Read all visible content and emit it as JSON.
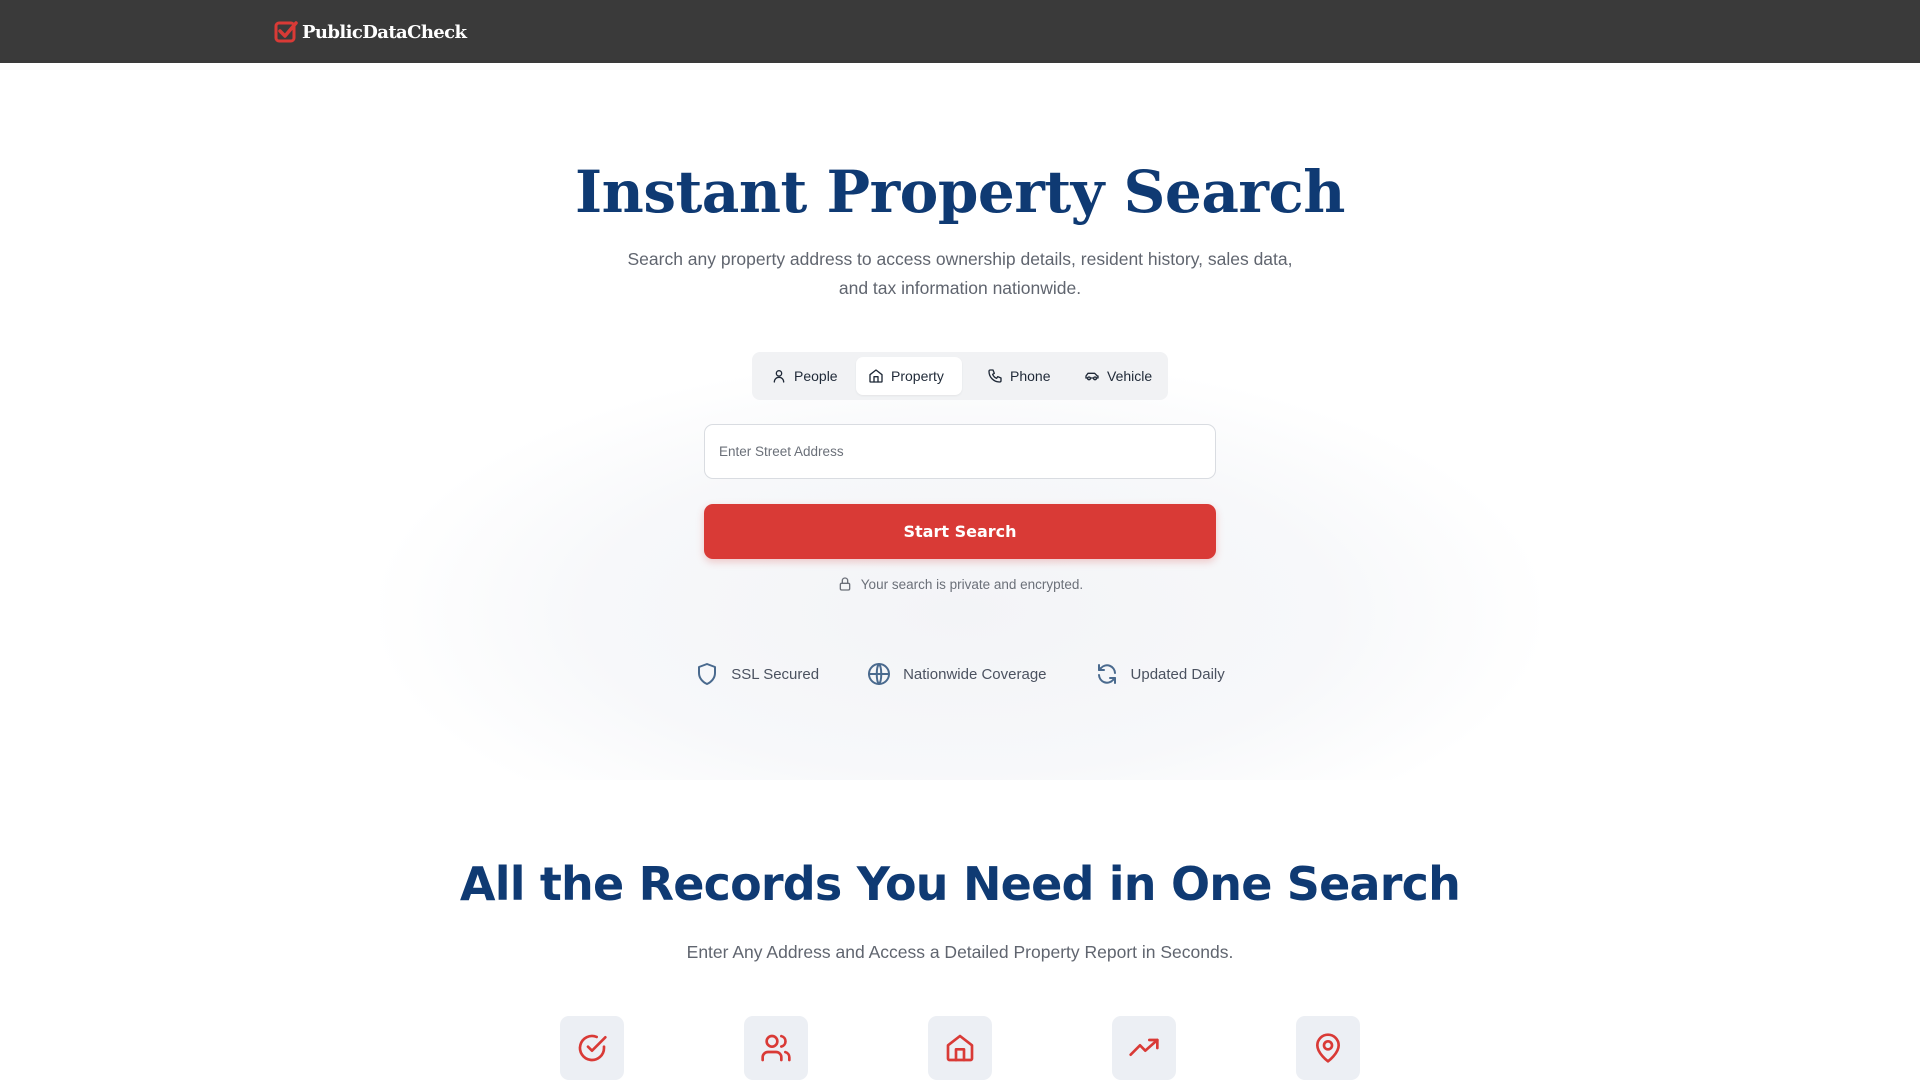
{
  "brand": {
    "name": "PublicDataCheck",
    "accent_color": "#d93a36",
    "title_color": "#0f3a73",
    "header_bg": "#3a3a3a"
  },
  "hero": {
    "title": "Instant Property Search",
    "subtitle_line1": "Search any property address to access ownership details, resident history, sales data,",
    "subtitle_line2": "and tax information nationwide."
  },
  "tabs": [
    {
      "label": "People",
      "icon": "user-icon",
      "active": false
    },
    {
      "label": "Property",
      "icon": "home-icon",
      "active": true
    },
    {
      "label": "Phone",
      "icon": "phone-icon",
      "active": false
    },
    {
      "label": "Vehicle",
      "icon": "car-icon",
      "active": false
    }
  ],
  "search": {
    "placeholder": "Enter Street Address",
    "value": "",
    "button_label": "Start Search",
    "privacy_note": "Your search is private and encrypted."
  },
  "badges": [
    {
      "label": "SSL Secured",
      "icon": "shield-icon"
    },
    {
      "label": "Nationwide Coverage",
      "icon": "globe-icon"
    },
    {
      "label": "Updated Daily",
      "icon": "refresh-icon"
    }
  ],
  "records": {
    "title": "All the Records You Need in One Search",
    "subtitle": "Enter Any Address and Access a Detailed Property Report in Seconds.",
    "feature_icons": [
      "check-circle-icon",
      "users-icon",
      "home-icon",
      "trending-up-icon",
      "map-pin-icon"
    ]
  }
}
